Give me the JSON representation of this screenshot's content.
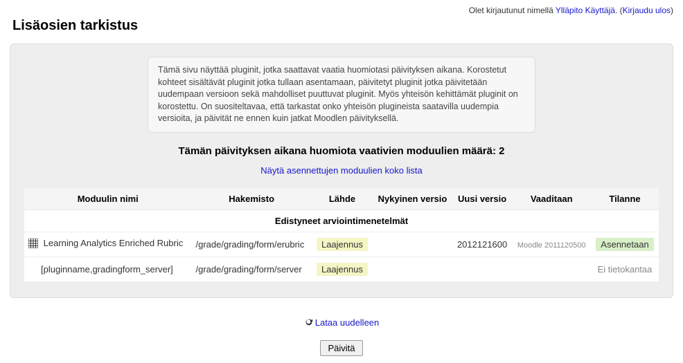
{
  "login": {
    "prefix": "Olet kirjautunut nimellä ",
    "username": "Ylläpito Käyttäjä",
    "logout": "Kirjaudu ulos"
  },
  "title": "Lisäosien tarkistus",
  "info_text": "Tämä sivu näyttää pluginit, jotka saattavat vaatia huomiotasi päivityksen aikana. Korostetut kohteet sisältävät pluginit jotka tullaan asentamaan, päivitetyt pluginit jotka päivitetään uudempaan versioon sekä mahdolliset puuttuvat pluginit. Myös yhteisön kehittämät pluginit on korostettu. On suositeltavaa, että tarkastat onko yhteisön plugineista saatavilla uudempia versioita, ja päivität ne ennen kuin jatkat Moodlen päivityksellä.",
  "count_heading": "Tämän päivityksen aikana huomiota vaativien moduulien määrä: 2",
  "full_list_link": "Näytä asennettujen moduulien koko lista",
  "table": {
    "headers": {
      "name": "Moduulin nimi",
      "dir": "Hakemisto",
      "source": "Lähde",
      "current": "Nykyinen versio",
      "new": "Uusi versio",
      "required": "Vaaditaan",
      "status": "Tilanne"
    },
    "section": "Edistyneet arviointimenetelmät",
    "rows": [
      {
        "name": "Learning Analytics Enriched Rubric",
        "dir": "/grade/grading/form/erubric",
        "source": "Laajennus",
        "current": "",
        "new": "2012121600",
        "required": "Moodle 2011120500",
        "status": "Asennetaan",
        "status_style": "install"
      },
      {
        "name": "[pluginname,gradingform_server]",
        "dir": "/grade/grading/form/server",
        "source": "Laajennus",
        "current": "",
        "new": "",
        "required": "",
        "status": "Ei tietokantaa",
        "status_style": "grey"
      }
    ]
  },
  "reload_label": "Lataa uudelleen",
  "update_button": "Päivitä"
}
